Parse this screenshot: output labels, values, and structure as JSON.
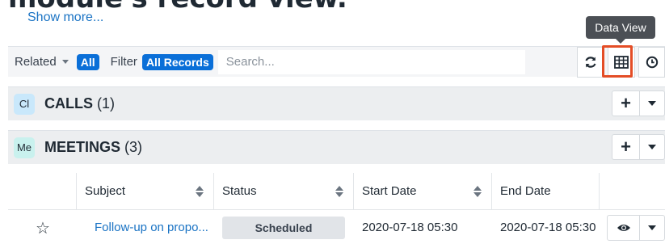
{
  "heading_fragment": "module's record view.",
  "show_more": "Show more...",
  "tooltip": "Data View",
  "toolbar": {
    "related_label": "Related",
    "related_value": "All",
    "filter_label": "Filter",
    "filter_value": "All Records",
    "search_placeholder": "Search...",
    "refresh_icon": "refresh-icon",
    "dataview_icon": "grid-icon",
    "timeline_icon": "clock-icon"
  },
  "subpanels": [
    {
      "badge": "Cl",
      "title": "CALLS",
      "count": "(1)"
    },
    {
      "badge": "Me",
      "title": "MEETINGS",
      "count": "(3)"
    }
  ],
  "columns": [
    "Subject",
    "Status",
    "Start Date",
    "End Date"
  ],
  "rows": [
    {
      "subject": "Follow-up on propo...",
      "status": "Scheduled",
      "start_date": "2020-07-18 05:30",
      "end_date": "2020-07-18 05:30"
    }
  ],
  "colors": {
    "accent": "#0a6fd8",
    "link": "#1a73c4",
    "highlight": "#e44d26",
    "panel_bg": "#eceef0"
  }
}
